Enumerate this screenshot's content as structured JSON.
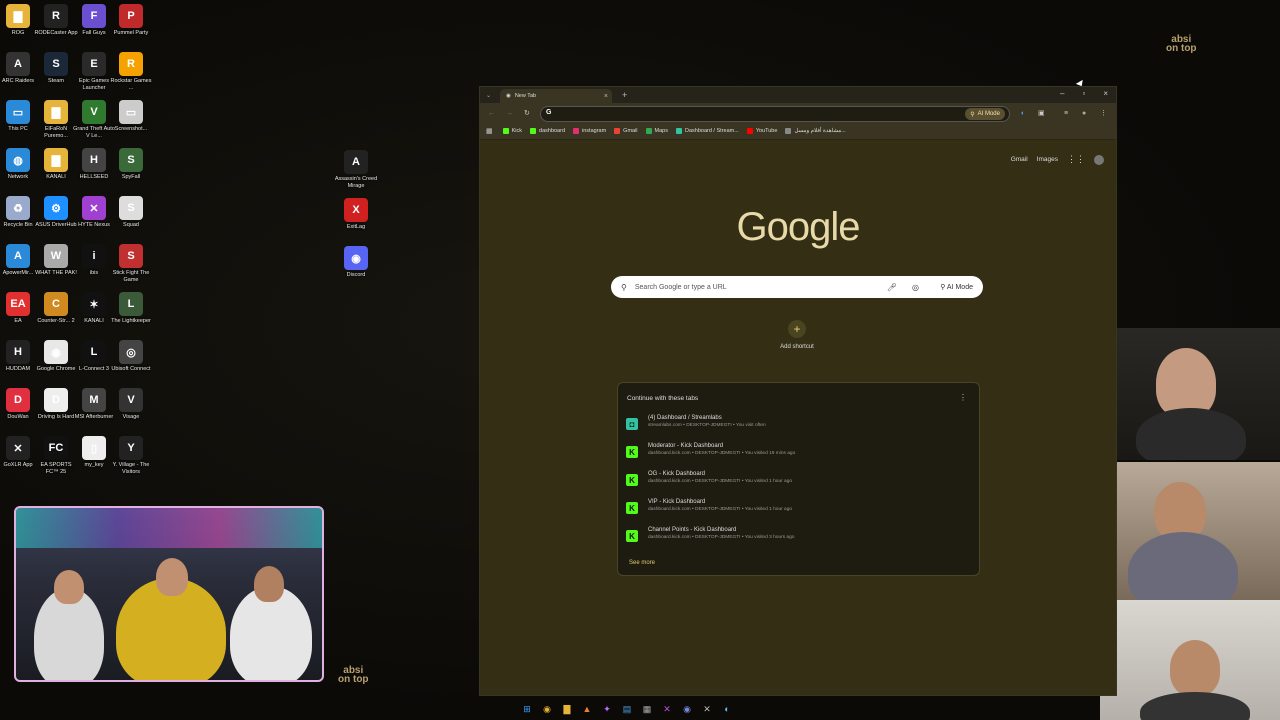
{
  "brand": {
    "text_top": "absi\non top",
    "text_bottom": "absi\non top"
  },
  "desktop": {
    "icons": [
      {
        "label": "ROG",
        "color": "#e6b43a",
        "glyph": "▇"
      },
      {
        "label": "RODECaster App",
        "color": "#222",
        "glyph": "R"
      },
      {
        "label": "Fall Guys",
        "color": "#6a4fd0",
        "glyph": "F"
      },
      {
        "label": "Pummel Party",
        "color": "#c02a2a",
        "glyph": "P"
      },
      {
        "label": "ARC Raiders",
        "color": "#333",
        "glyph": "A"
      },
      {
        "label": "Steam",
        "color": "#1b2838",
        "glyph": "S"
      },
      {
        "label": "Epic Games Launcher",
        "color": "#2a2a2a",
        "glyph": "E"
      },
      {
        "label": "Rockstar Games ...",
        "color": "#f5a100",
        "glyph": "R"
      },
      {
        "label": "This PC",
        "color": "#2b8ad8",
        "glyph": "▭"
      },
      {
        "label": "ElFaRoN Puremo...",
        "color": "#e6b43a",
        "glyph": "▇"
      },
      {
        "label": "Grand Theft Auto V Le...",
        "color": "#2f7a2f",
        "glyph": "V"
      },
      {
        "label": "Screenshot...",
        "color": "#ccc",
        "glyph": "▭"
      },
      {
        "label": "Network",
        "color": "#2b8ad8",
        "glyph": "◍"
      },
      {
        "label": "KANALI",
        "color": "#e6b43a",
        "glyph": "▇"
      },
      {
        "label": "HELLSEED",
        "color": "#444",
        "glyph": "H"
      },
      {
        "label": "SpyFall",
        "color": "#3a6a3a",
        "glyph": "S"
      },
      {
        "label": "Recycle Bin",
        "color": "#9ac",
        "glyph": "♻"
      },
      {
        "label": "ASUS DriverHub",
        "color": "#1e90ff",
        "glyph": "⚙"
      },
      {
        "label": "HYTE Nexus",
        "color": "#a040d0",
        "glyph": "✕"
      },
      {
        "label": "Squad",
        "color": "#ddd",
        "glyph": "S"
      },
      {
        "label": "ApowerMir...",
        "color": "#2b8ad8",
        "glyph": "A"
      },
      {
        "label": "WHAT THE PAK!",
        "color": "#aaa",
        "glyph": "W"
      },
      {
        "label": "ibis",
        "color": "#111",
        "glyph": "i"
      },
      {
        "label": "Stick Fight The Game",
        "color": "#c03030",
        "glyph": "S"
      },
      {
        "label": "EA",
        "color": "#e03030",
        "glyph": "EA"
      },
      {
        "label": "Counter-Str... 2",
        "color": "#d08a20",
        "glyph": "C"
      },
      {
        "label": "KANALI",
        "color": "#111",
        "glyph": "✶"
      },
      {
        "label": "The Lightkeeper",
        "color": "#3a5a3a",
        "glyph": "L"
      },
      {
        "label": "HUDDAM",
        "color": "#222",
        "glyph": "H"
      },
      {
        "label": "Google Chrome",
        "color": "#e8e8e8",
        "glyph": "◉"
      },
      {
        "label": "L-Connect 3",
        "color": "#111",
        "glyph": "L"
      },
      {
        "label": "Ubisoft Connect",
        "color": "#444",
        "glyph": "◎"
      },
      {
        "label": "DouWan",
        "color": "#e03040",
        "glyph": "D"
      },
      {
        "label": "Driving Is Hard",
        "color": "#eee",
        "glyph": "D"
      },
      {
        "label": "MSI Afterburner",
        "color": "#444",
        "glyph": "M"
      },
      {
        "label": "Visage",
        "color": "#333",
        "glyph": "V"
      },
      {
        "label": "GoXLR App",
        "color": "#222",
        "glyph": "✕"
      },
      {
        "label": "EA SPORTS FC™ 25",
        "color": "#111",
        "glyph": "FC"
      },
      {
        "label": "my_key",
        "color": "#eee",
        "glyph": "▯"
      },
      {
        "label": "Y. Village - The Visitors",
        "color": "#222",
        "glyph": "Y"
      }
    ],
    "extra_icons": [
      {
        "label": "Assassin's Creed Mirage",
        "color": "#222",
        "glyph": "A"
      },
      {
        "label": "ExitLag",
        "color": "#d02020",
        "glyph": "X"
      },
      {
        "label": "Discord",
        "color": "#5865f2",
        "glyph": "◉"
      }
    ]
  },
  "browser": {
    "tab_title": "New Tab",
    "omnibox_value": "",
    "ai_mode_label": "AI Mode",
    "bookmarks": [
      {
        "label": "Kick",
        "color": "#53fc18"
      },
      {
        "label": "dashboard",
        "color": "#53fc18"
      },
      {
        "label": "instagram",
        "color": "#e1306c"
      },
      {
        "label": "Gmail",
        "color": "#ea4335"
      },
      {
        "label": "Maps",
        "color": "#34a853"
      },
      {
        "label": "Dashboard / Stream...",
        "color": "#31c3a2"
      },
      {
        "label": "YouTube",
        "color": "#ff0000"
      },
      {
        "label": "مشاهدة أفلام ومسل...",
        "color": "#888"
      }
    ],
    "top_links": {
      "gmail": "Gmail",
      "images": "Images"
    },
    "logo": "Google",
    "search_placeholder": "Search Google or type a URL",
    "search_ai_mode": "AI Mode",
    "add_shortcut": "Add shortcut",
    "continue_header": "Continue with these tabs",
    "tabs": [
      {
        "title": "(4) Dashboard / Streamlabs",
        "meta": "streamlabs.com • DESKTOP-JDMEGTI • You visit often",
        "fav_color": "#31c3a2",
        "glyph": "◘"
      },
      {
        "title": "Moderator - Kick Dashboard",
        "meta": "dashboard.kick.com • DESKTOP-JDMEGTI • You visited 19 mins ago",
        "fav_color": "#53fc18",
        "glyph": "K"
      },
      {
        "title": "OG - Kick Dashboard",
        "meta": "dashboard.kick.com • DESKTOP-JDMEGTI • You visited 1 hour ago",
        "fav_color": "#53fc18",
        "glyph": "K"
      },
      {
        "title": "VIP - Kick Dashboard",
        "meta": "dashboard.kick.com • DESKTOP-JDMEGTI • You visited 1 hour ago",
        "fav_color": "#53fc18",
        "glyph": "K"
      },
      {
        "title": "Channel Points - Kick Dashboard",
        "meta": "dashboard.kick.com • DESKTOP-JDMEGTI • You visited 3 hours ago",
        "fav_color": "#53fc18",
        "glyph": "K"
      }
    ],
    "see_more": "See more"
  },
  "taskbar": {
    "icons": [
      {
        "name": "windows-start-icon",
        "glyph": "⊞",
        "color": "#3aa0ff"
      },
      {
        "name": "chrome-icon",
        "glyph": "◉",
        "color": "#e8b030"
      },
      {
        "name": "file-explorer-icon",
        "glyph": "▇",
        "color": "#e6b43a"
      },
      {
        "name": "app-icon",
        "glyph": "▲",
        "color": "#f08030"
      },
      {
        "name": "app-icon-2",
        "glyph": "✦",
        "color": "#c070ff"
      },
      {
        "name": "notepad-icon",
        "glyph": "▤",
        "color": "#4aa0e0"
      },
      {
        "name": "calc-icon",
        "glyph": "▦",
        "color": "#aaa"
      },
      {
        "name": "hyte-icon",
        "glyph": "✕",
        "color": "#c050e0"
      },
      {
        "name": "discord-icon",
        "glyph": "◉",
        "color": "#7289da"
      },
      {
        "name": "goxlr-icon",
        "glyph": "✕",
        "color": "#bbb"
      },
      {
        "name": "steam-icon",
        "glyph": "◐",
        "color": "#66c0f4"
      }
    ]
  }
}
